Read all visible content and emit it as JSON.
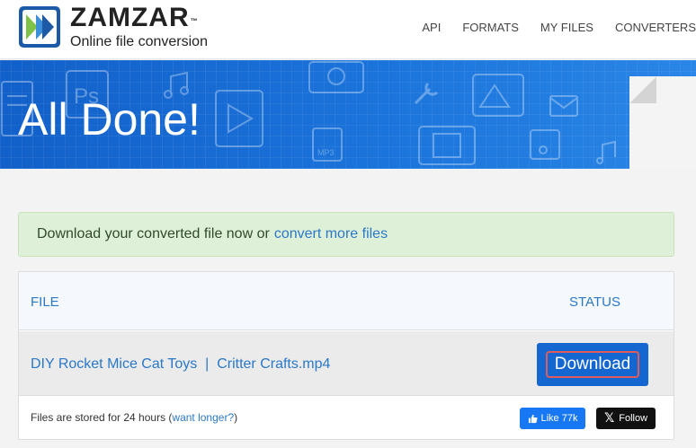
{
  "brand": {
    "name": "ZAMZAR",
    "tm": "™",
    "tagline": "Online file conversion"
  },
  "nav": {
    "items": [
      "API",
      "FORMATS",
      "MY FILES",
      "CONVERTERS"
    ]
  },
  "banner": {
    "title": "All Done!"
  },
  "alert": {
    "text": "Download your converted file now or",
    "link": "convert more files"
  },
  "table": {
    "headers": {
      "file": "FILE",
      "status": "STATUS"
    },
    "row": {
      "file_name": "DIY Rocket Mice Cat Toys  |  Critter Crafts.mp4",
      "button": "Download"
    },
    "footer": {
      "text": "Files are stored for 24 hours (",
      "link": "want longer?",
      "text_end": ")"
    },
    "social": {
      "like": "Like 77k",
      "follow": "Follow"
    }
  },
  "colors": {
    "accent": "#2a78c8",
    "banner": "#1b74db",
    "download_button": "#1467d0",
    "alert_bg": "#dff0d8"
  }
}
